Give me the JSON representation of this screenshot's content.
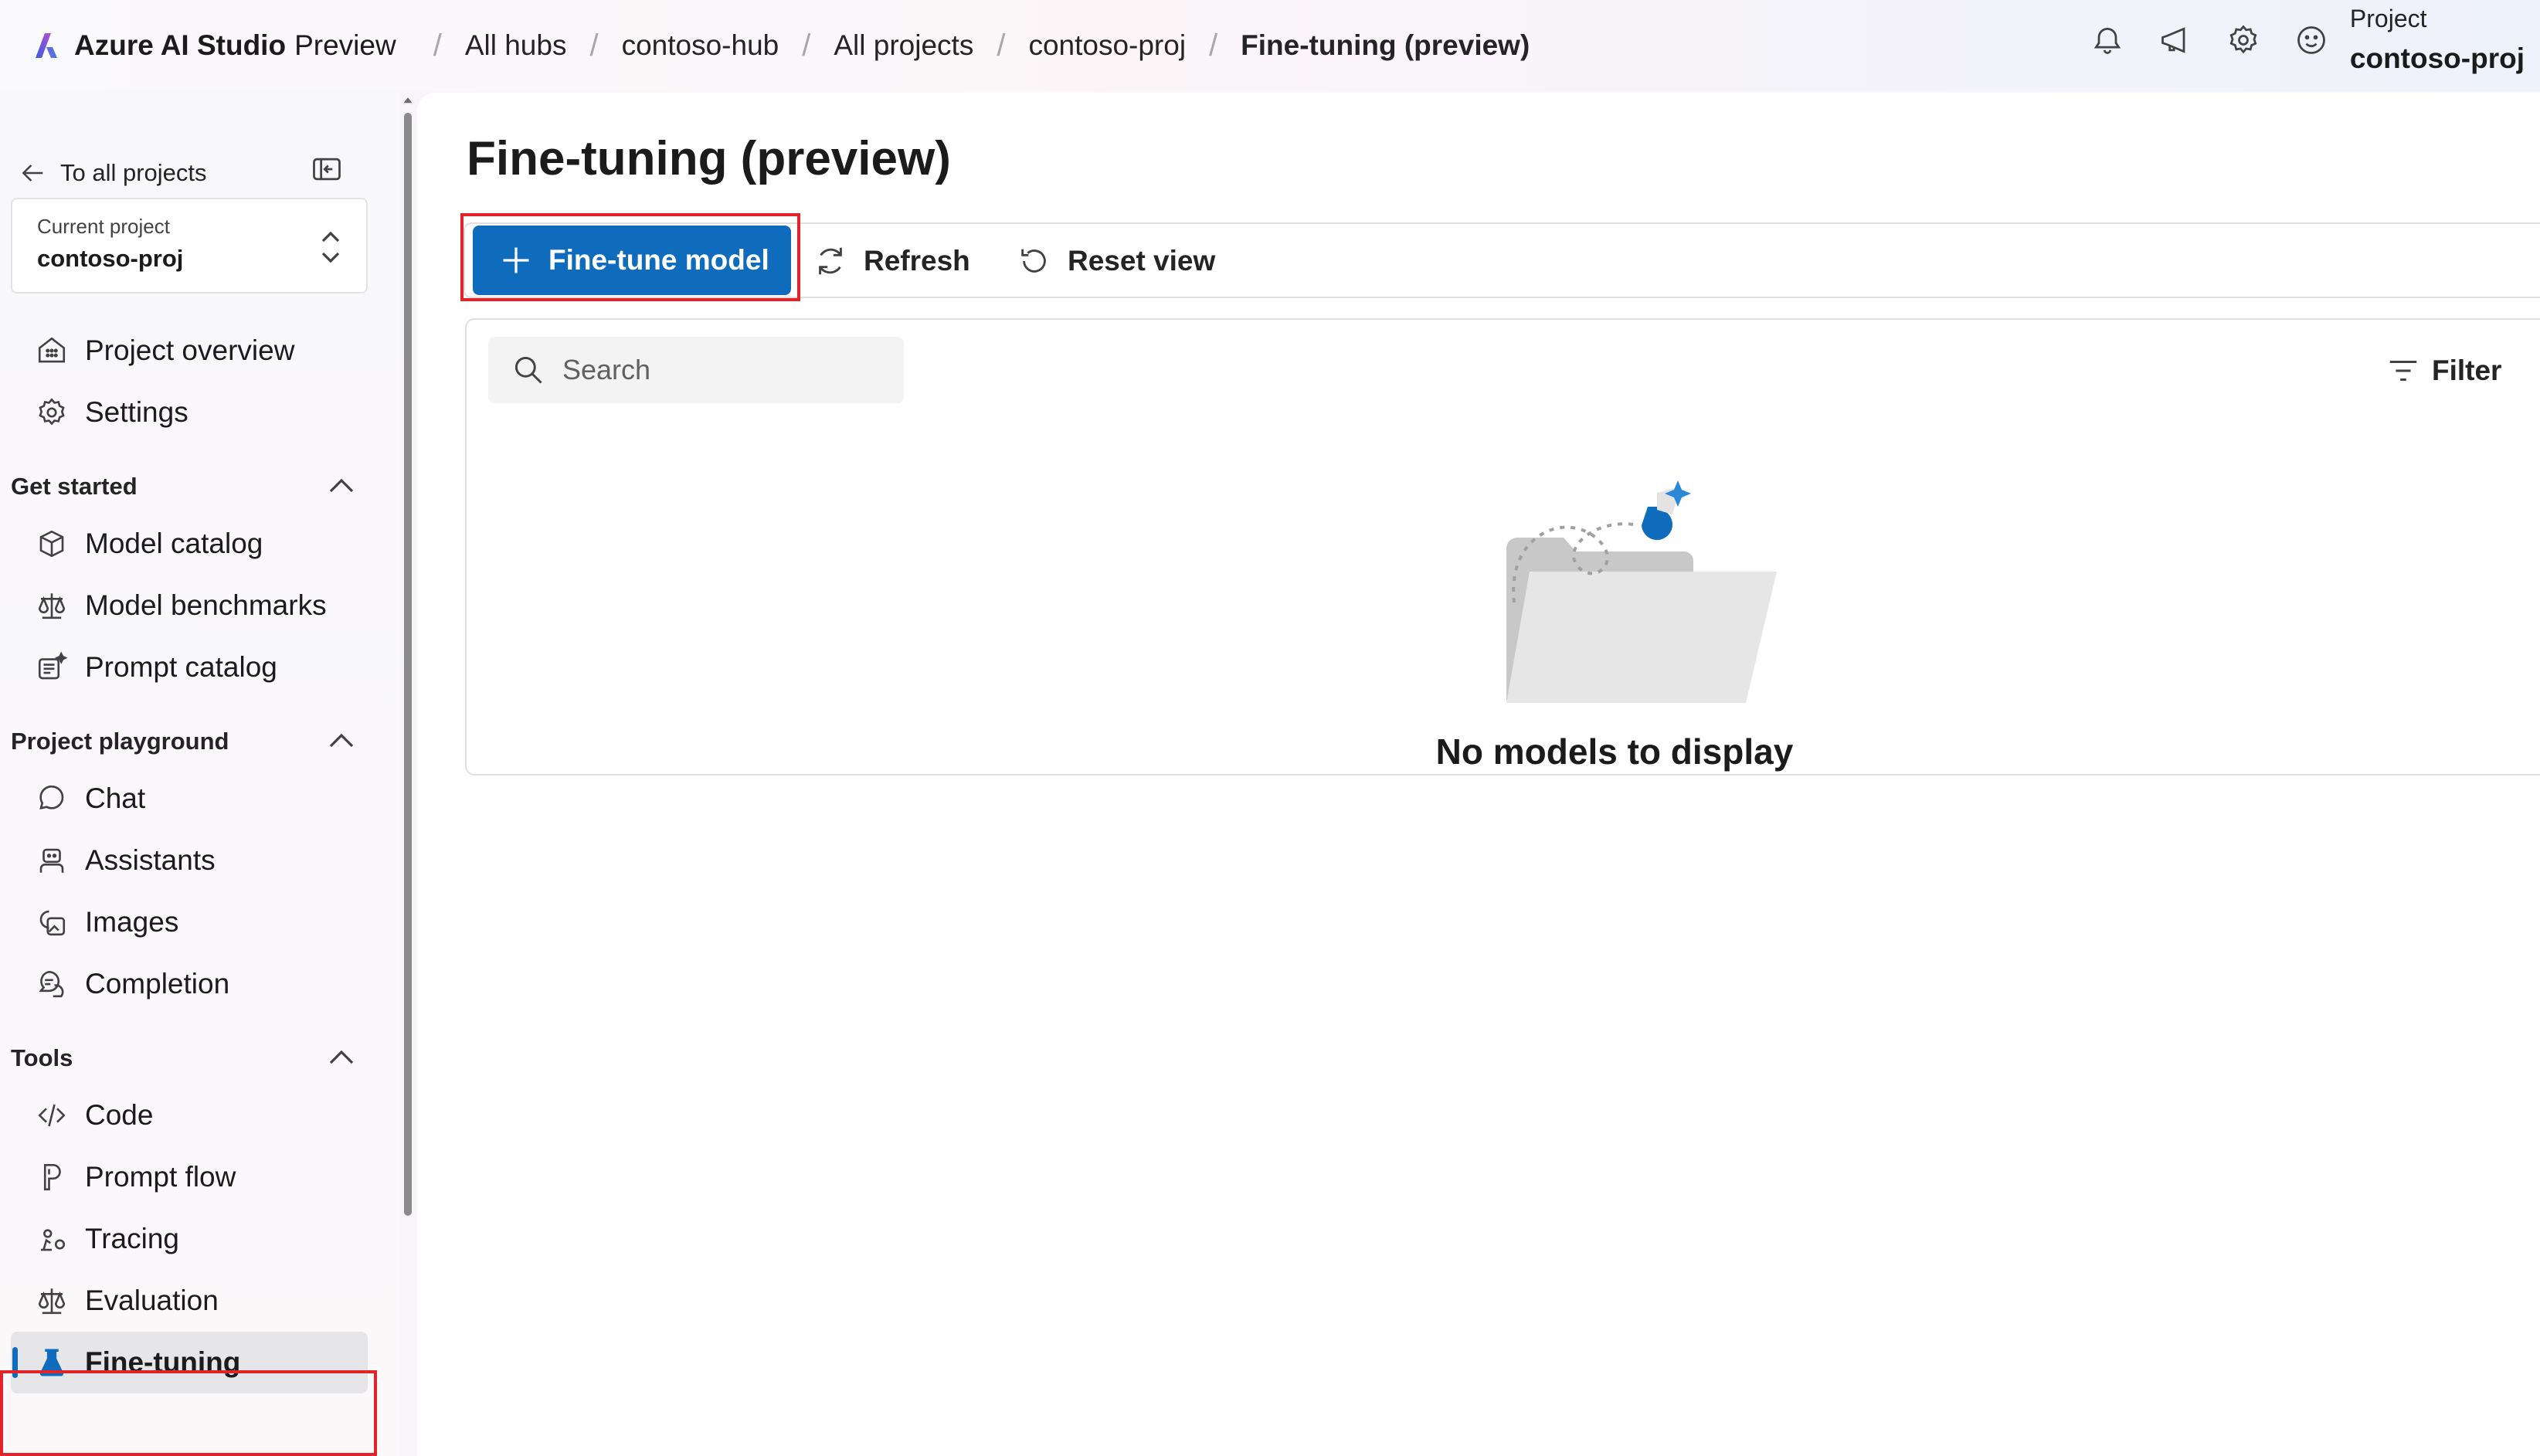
{
  "app": {
    "brand_name": "Azure AI Studio",
    "brand_suffix": "Preview"
  },
  "breadcrumbs": [
    "All hubs",
    "contoso-hub",
    "All projects",
    "contoso-proj",
    "Fine-tuning (preview)"
  ],
  "header": {
    "project_label": "Project",
    "project_name": "contoso-proj",
    "icons": [
      "bell-icon",
      "megaphone-icon",
      "gear-icon",
      "smiley-icon"
    ]
  },
  "sidebar": {
    "back_label": "To all projects",
    "current_project_label": "Current project",
    "current_project_value": "contoso-proj",
    "top_items": [
      {
        "label": "Project overview",
        "icon": "grid-icon"
      },
      {
        "label": "Settings",
        "icon": "gear-icon"
      }
    ],
    "sections": [
      {
        "title": "Get started",
        "items": [
          {
            "label": "Model catalog",
            "icon": "cube-icon"
          },
          {
            "label": "Model benchmarks",
            "icon": "scale-icon"
          },
          {
            "label": "Prompt catalog",
            "icon": "sparkle-list-icon"
          }
        ]
      },
      {
        "title": "Project playground",
        "items": [
          {
            "label": "Chat",
            "icon": "chat-icon"
          },
          {
            "label": "Assistants",
            "icon": "bot-icon"
          },
          {
            "label": "Images",
            "icon": "image-icon"
          },
          {
            "label": "Completion",
            "icon": "completion-icon"
          }
        ]
      },
      {
        "title": "Tools",
        "items": [
          {
            "label": "Code",
            "icon": "code-icon"
          },
          {
            "label": "Prompt flow",
            "icon": "flow-icon"
          },
          {
            "label": "Tracing",
            "icon": "tracing-icon"
          },
          {
            "label": "Evaluation",
            "icon": "scale-icon"
          },
          {
            "label": "Fine-tuning",
            "icon": "flask-icon",
            "active": true
          }
        ]
      }
    ]
  },
  "main": {
    "title": "Fine-tuning (preview)",
    "toolbar": {
      "primary_label": "Fine-tune model",
      "refresh_label": "Refresh",
      "reset_label": "Reset view"
    },
    "search_placeholder": "Search",
    "filter_label": "Filter",
    "empty_message": "No models to display"
  },
  "colors": {
    "accent": "#0f6cbd",
    "highlight": "#e0242a"
  }
}
